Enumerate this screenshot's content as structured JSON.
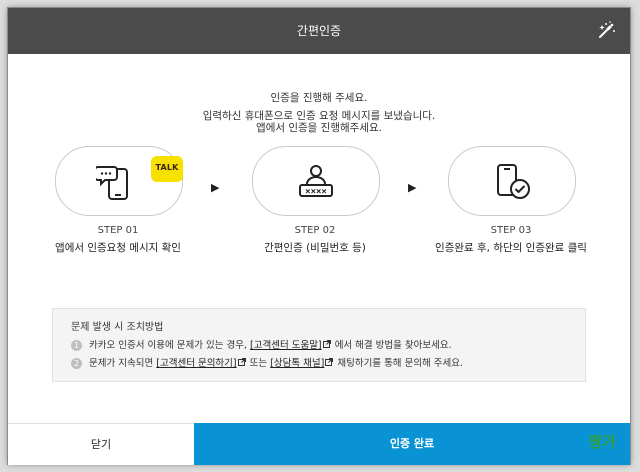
{
  "header": {
    "title": "간편인증"
  },
  "intro": {
    "line1": "인증을 진행해 주세요.",
    "line2": "입력하신 휴대폰으로 인증 요청 메시지를 보냈습니다.",
    "line3": "앱에서 인증을 진행해주세요."
  },
  "steps": [
    {
      "label": "STEP 01",
      "desc": "앱에서 인증요청 메시지 확인",
      "badge": "TALK",
      "icon": "phone-chat-icon"
    },
    {
      "label": "STEP 02",
      "desc": "간편인증 (비밀번호 등)",
      "icon": "password-user-icon"
    },
    {
      "label": "STEP 03",
      "desc": "인증완료 후, 하단의 인증완료 클릭",
      "icon": "phone-check-icon"
    }
  ],
  "arrow_glyph": "▶",
  "info": {
    "title": "문제 발생 시 조치방법",
    "item1": {
      "num": "1",
      "pre": "카카오 인증서 이용에 문제가 있는 경우,",
      "link": "[고객센터 도움말]",
      "post": "에서 해결 방법을 찾아보세요."
    },
    "item2": {
      "num": "2",
      "pre": "문제가 지속되면",
      "link1": "[고객센터 문의하기]",
      "mid": "또는",
      "link2": "[상담톡 채널]",
      "post": "채팅하기를 통해 문의해 주세요."
    }
  },
  "footer": {
    "close_label": "닫기",
    "confirm_label": "인증 완료",
    "watermark": "짱가"
  },
  "colors": {
    "header": "#4b4b4b",
    "confirm": "#0a93d4",
    "kakao": "#f7e100",
    "watermark": "#2ea043"
  }
}
